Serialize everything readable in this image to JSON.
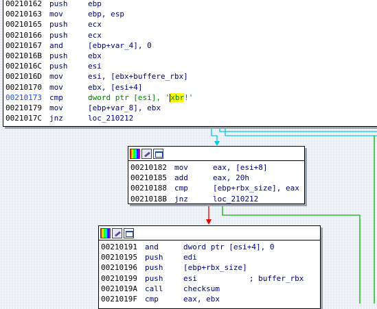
{
  "block1": {
    "lines": [
      {
        "addr": "00210162",
        "mnem": "push",
        "ops": "ebp"
      },
      {
        "addr": "00210163",
        "mnem": "mov",
        "ops": "ebp, esp"
      },
      {
        "addr": "00210165",
        "mnem": "push",
        "ops": "ecx"
      },
      {
        "addr": "00210166",
        "mnem": "push",
        "ops": "ecx"
      },
      {
        "addr": "00210167",
        "mnem": "and",
        "ops": "[ebp+var_4], 0"
      },
      {
        "addr": "0021016B",
        "mnem": "push",
        "ops": "ebx"
      },
      {
        "addr": "0021016C",
        "mnem": "push",
        "ops": "esi"
      },
      {
        "addr": "0021016D",
        "mnem": "mov",
        "ops": "esi, [ebx+buffere_rbx]"
      },
      {
        "addr": "00210170",
        "mnem": "mov",
        "ops": "ebx, [esi+4]"
      },
      {
        "addr": "00210173",
        "mnem": "cmp",
        "ops_pre": "dword ptr [esi], '",
        "ops_hl": "xbr",
        "ops_post": "!'"
      },
      {
        "addr": "00210179",
        "mnem": "mov",
        "ops": "[ebp+var_8], ebx"
      },
      {
        "addr": "0021017C",
        "mnem": "jnz",
        "ops": "loc_210212"
      }
    ]
  },
  "block2": {
    "lines": [
      {
        "addr": "00210182",
        "mnem": "mov",
        "ops": "eax, [esi+8]"
      },
      {
        "addr": "00210185",
        "mnem": "add",
        "ops": "eax, 20h"
      },
      {
        "addr": "00210188",
        "mnem": "cmp",
        "ops": "[ebp+rbx_size], eax"
      },
      {
        "addr": "0021018B",
        "mnem": "jnz",
        "ops": "loc_210212"
      }
    ]
  },
  "block3": {
    "lines": [
      {
        "addr": "00210191",
        "mnem": "and",
        "ops": "dword ptr [esi+4], 0"
      },
      {
        "addr": "00210195",
        "mnem": "push",
        "ops": "edi"
      },
      {
        "addr": "00210196",
        "mnem": "push",
        "ops": "[ebp+rbx_size]"
      },
      {
        "addr": "00210199",
        "mnem": "push",
        "ops": "esi",
        "comment": "; buffer_rbx"
      },
      {
        "addr": "0021019A",
        "mnem": "call",
        "ops": "checksum"
      },
      {
        "addr": "0021019F",
        "mnem": "cmp",
        "ops": "eax, ebx"
      }
    ]
  },
  "icons": [
    "color-palette-icon",
    "edit-pencil-icon",
    "graph-view-icon"
  ],
  "colors": {
    "edge_taken": "#e60000",
    "edge_fall": "#00b300",
    "edge_uncond": "#00c8e6",
    "highlight": "#ffff00"
  }
}
